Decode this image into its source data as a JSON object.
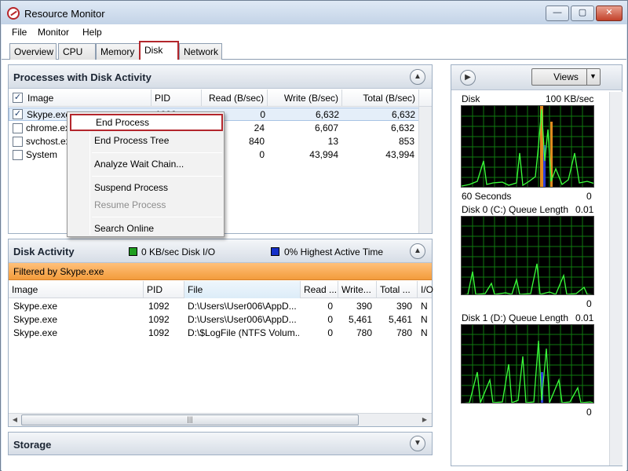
{
  "window": {
    "title": "Resource Monitor",
    "minimize": "—",
    "maximize": "▢",
    "close": "✕"
  },
  "menu": [
    "File",
    "Monitor",
    "Help"
  ],
  "tabs": [
    "Overview",
    "CPU",
    "Memory",
    "Disk",
    "Network"
  ],
  "active_tab": "Disk",
  "processes": {
    "title": "Processes with Disk Activity",
    "columns": [
      "Image",
      "PID",
      "Read (B/sec)",
      "Write (B/sec)",
      "Total (B/sec)"
    ],
    "rows": [
      {
        "checked": true,
        "image": "Skype.exe",
        "pid": "1092",
        "read": "0",
        "write": "6,632",
        "total": "6,632"
      },
      {
        "checked": false,
        "image": "chrome.exe",
        "pid": "",
        "read": "24",
        "write": "6,607",
        "total": "6,632"
      },
      {
        "checked": false,
        "image": "svchost.exe",
        "pid": "",
        "read": "840",
        "write": "13",
        "total": "853"
      },
      {
        "checked": false,
        "image": "System",
        "pid": "",
        "read": "0",
        "write": "43,994",
        "total": "43,994"
      }
    ]
  },
  "context_menu": {
    "items": [
      "End Process",
      "End Process Tree",
      "Analyze Wait Chain...",
      "Suspend Process",
      "Resume Process",
      "Search Online"
    ],
    "highlighted": "End Process",
    "disabled": [
      "Resume Process"
    ]
  },
  "disk_activity": {
    "title": "Disk Activity",
    "legend_io": "0 KB/sec Disk I/O",
    "legend_active": "0% Highest Active Time",
    "io_color": "#1f9e1f",
    "active_color": "#1530c8",
    "filter": "Filtered by Skype.exe",
    "columns": [
      "Image",
      "PID",
      "File",
      "Read ...",
      "Write...",
      "Total ...",
      "I/O"
    ],
    "rows": [
      {
        "image": "Skype.exe",
        "pid": "1092",
        "file": "D:\\Users\\User006\\AppD...",
        "read": "0",
        "write": "390",
        "total": "390",
        "io": "N"
      },
      {
        "image": "Skype.exe",
        "pid": "1092",
        "file": "D:\\Users\\User006\\AppD...",
        "read": "0",
        "write": "5,461",
        "total": "5,461",
        "io": "N"
      },
      {
        "image": "Skype.exe",
        "pid": "1092",
        "file": "D:\\$LogFile (NTFS Volum...",
        "read": "0",
        "write": "780",
        "total": "780",
        "io": "N"
      }
    ]
  },
  "storage": {
    "title": "Storage"
  },
  "right_pane": {
    "views_label": "Views",
    "graphs": [
      {
        "title": "Disk",
        "max": "100 KB/sec",
        "foot_left": "60 Seconds",
        "foot_right": "0"
      },
      {
        "title": "Disk 0 (C:) Queue Length",
        "max": "0.01",
        "foot_left": "",
        "foot_right": "0"
      },
      {
        "title": "Disk 1 (D:) Queue Length",
        "max": "0.01",
        "foot_left": "",
        "foot_right": "0"
      }
    ]
  }
}
